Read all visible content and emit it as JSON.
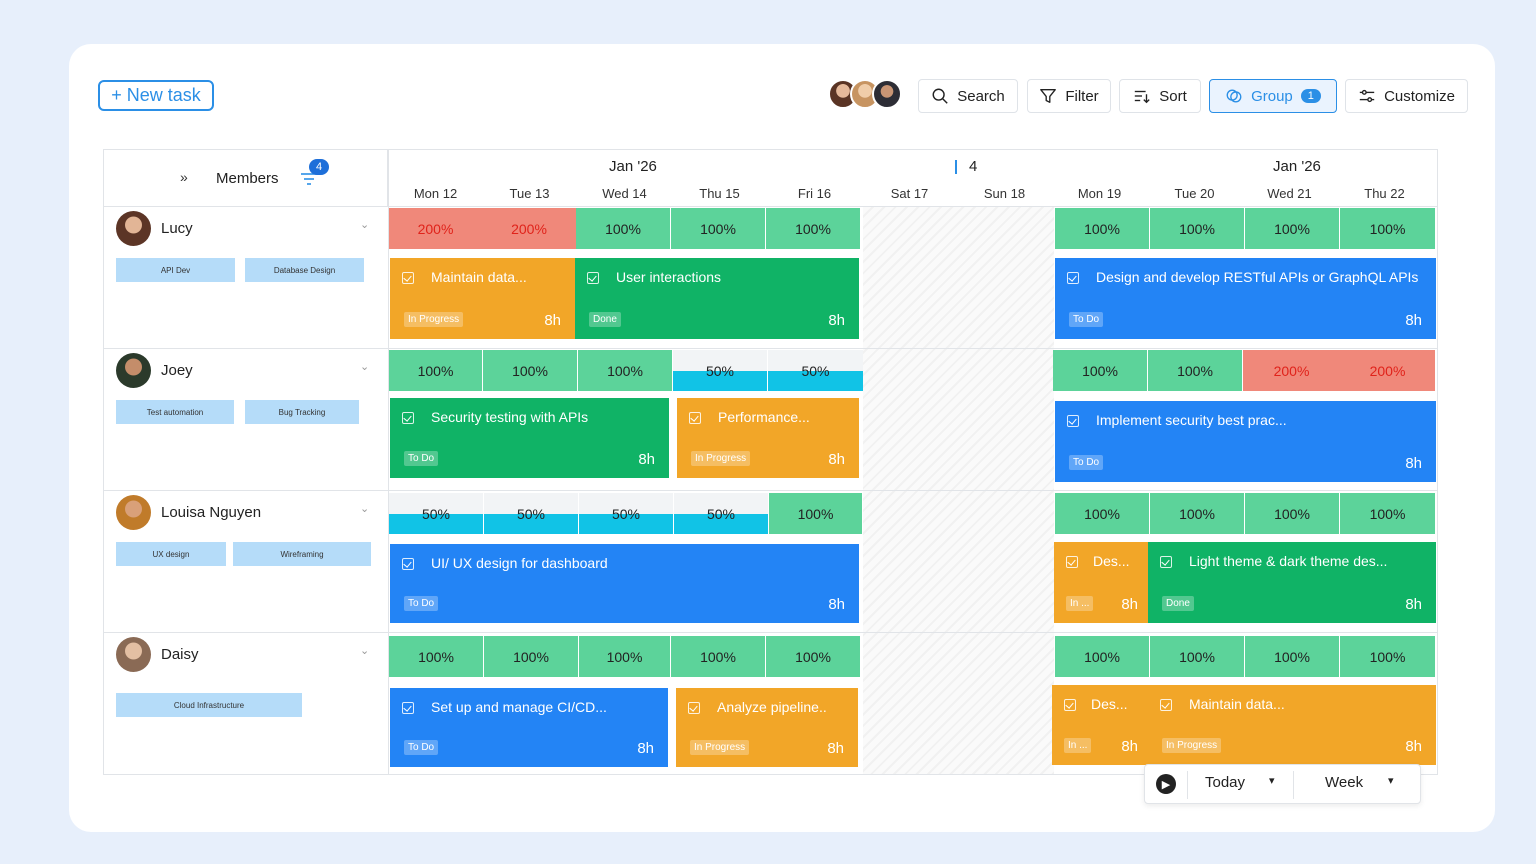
{
  "toolbar": {
    "new_task": "+ New task",
    "search": "Search",
    "filter": "Filter",
    "sort": "Sort",
    "group": "Group",
    "group_count": "1",
    "customize": "Customize"
  },
  "header": {
    "members_label": "Members",
    "filter_count": "4",
    "month_left": "Jan '26",
    "week_number": "4",
    "month_right": "Jan '26",
    "days": [
      "Mon 12",
      "Tue 13",
      "Wed 14",
      "Thu 15",
      "Fri 16",
      "Sat 17",
      "Sun 18",
      "Mon 19",
      "Tue 20",
      "Wed 21",
      "Thu 22"
    ]
  },
  "members": [
    {
      "name": "Lucy",
      "skills": [
        "API Dev",
        "Database Design"
      ],
      "capacity": [
        "200%",
        "200%",
        "100%",
        "100%",
        "100%",
        "100%",
        "100%",
        "100%",
        "100%"
      ],
      "tasks": [
        {
          "title": "Maintain data...",
          "status": "In Progress",
          "hours": "8h"
        },
        {
          "title": "User interactions",
          "status": "Done",
          "hours": "8h"
        },
        {
          "title": "Design and develop RESTful APIs or GraphQL APIs",
          "status": "To Do",
          "hours": "8h"
        }
      ]
    },
    {
      "name": "Joey",
      "skills": [
        "Test automation",
        "Bug Tracking"
      ],
      "capacity": [
        "100%",
        "100%",
        "100%",
        "50%",
        "50%",
        "100%",
        "100%",
        "200%",
        "200%"
      ],
      "tasks": [
        {
          "title": "Security testing with APIs",
          "status": "To Do",
          "hours": "8h"
        },
        {
          "title": "Performance...",
          "status": "In Progress",
          "hours": "8h"
        },
        {
          "title": "Implement security best prac...",
          "status": "To Do",
          "hours": "8h"
        }
      ]
    },
    {
      "name": "Louisa Nguyen",
      "skills": [
        "UX design",
        "Wireframing"
      ],
      "capacity": [
        "50%",
        "50%",
        "50%",
        "50%",
        "100%",
        "100%",
        "100%",
        "100%",
        "100%"
      ],
      "tasks": [
        {
          "title": "UI/ UX design for dashboard",
          "status": "To Do",
          "hours": "8h"
        },
        {
          "title": "Des...",
          "status": "In ...",
          "hours": "8h"
        },
        {
          "title": "Light theme & dark theme des...",
          "status": "Done",
          "hours": "8h"
        }
      ]
    },
    {
      "name": "Daisy",
      "skills": [
        "Cloud Infrastructure"
      ],
      "capacity": [
        "100%",
        "100%",
        "100%",
        "100%",
        "100%",
        "100%",
        "100%",
        "100%",
        "100%"
      ],
      "tasks": [
        {
          "title": "Set up and manage CI/CD...",
          "status": "To Do",
          "hours": "8h"
        },
        {
          "title": "Analyze pipeline..",
          "status": "In Progress",
          "hours": "8h"
        },
        {
          "title": "Des...",
          "status": "In ...",
          "hours": "8h"
        },
        {
          "title": "Maintain data...",
          "status": "In Progress",
          "hours": "8h"
        }
      ]
    }
  ],
  "nav": {
    "today": "Today",
    "view": "Week"
  },
  "colors": {
    "accent": "#2b8fe6",
    "capacity_ok": "#5cd39a",
    "capacity_over": "#f0887a",
    "capacity_partial": "#11c3e6",
    "task_in_progress": "#f2a628",
    "task_done": "#10b366",
    "task_todo": "#2384f5"
  }
}
